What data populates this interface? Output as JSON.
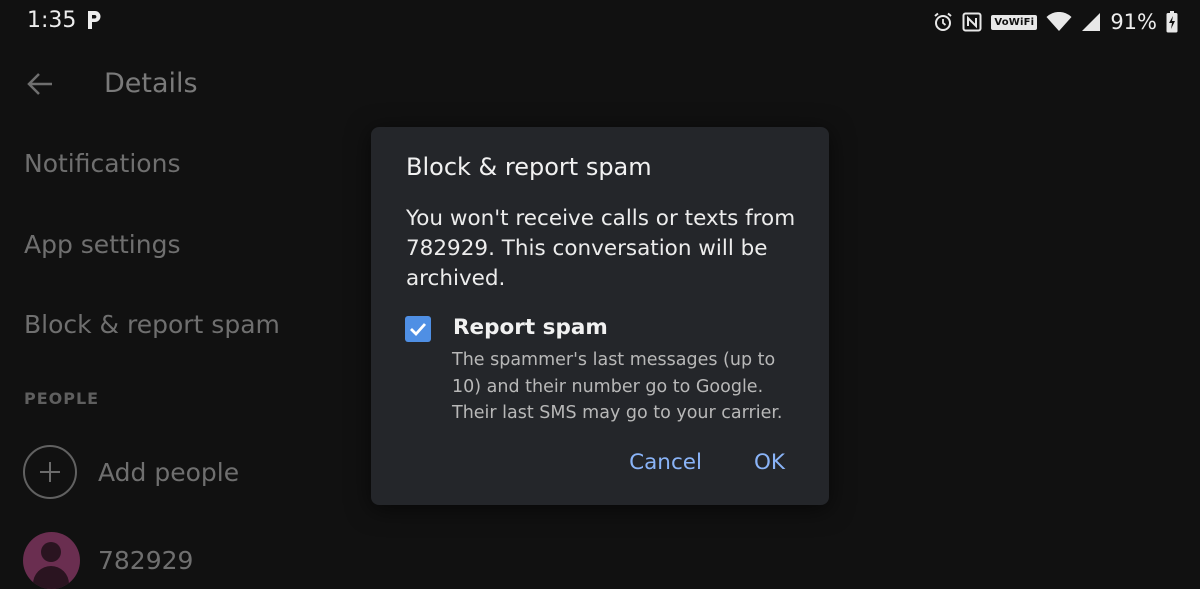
{
  "status_bar": {
    "time": "1:35",
    "vowifi_label": "VoWiFi",
    "battery_percent": "91%"
  },
  "details_page": {
    "title": "Details",
    "items": [
      {
        "label": "Notifications"
      },
      {
        "label": "App settings"
      },
      {
        "label": "Block & report spam"
      }
    ],
    "people_header": "PEOPLE",
    "add_people_label": "Add people",
    "contact_label": "782929"
  },
  "dialog": {
    "title": "Block & report spam",
    "body": "You won't receive calls or texts from 782929. This conversation will be archived.",
    "option": {
      "title": "Report spam",
      "description": "The spammer's last messages (up to 10) and their number go to Google. Their last SMS may go to your carrier.",
      "checked": true
    },
    "cancel_label": "Cancel",
    "ok_label": "OK"
  },
  "colors": {
    "accent": "#8ab4f8",
    "checkbox": "#4f8fe4",
    "avatar": "#6a2e50",
    "dialog_bg": "#24262a"
  },
  "icons": {
    "back": "arrow-back-icon",
    "parking": "parking-p-icon",
    "alarm": "alarm-icon",
    "nfc": "nfc-icon",
    "wifi": "wifi-icon",
    "signal": "signal-icon",
    "battery": "battery-charging-icon",
    "add": "add-circle-icon",
    "avatar": "person-icon",
    "check": "checkmark-icon"
  }
}
